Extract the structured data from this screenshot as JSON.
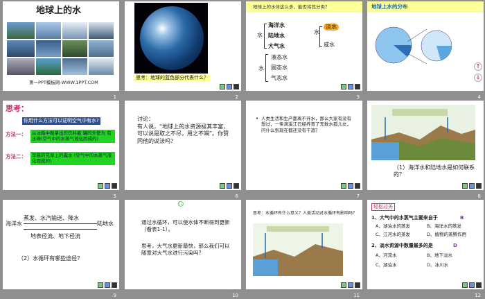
{
  "slides": [
    {
      "num": "1",
      "title": "地球上的水",
      "footer": "第一PPT模板网-WWW.1PPT.COM"
    },
    {
      "num": "2",
      "caption": "思考：地球的蓝色部分代表什么？"
    },
    {
      "num": "3",
      "question": "地球上的水体这么多，能否将其分类？",
      "left_col": [
        "海洋水",
        "陆地水",
        "大气水"
      ],
      "root": "水",
      "right_top": "淡水",
      "right_bottom": "咸水",
      "state_col": [
        "液态水",
        "固态水",
        "气态水"
      ]
    },
    {
      "num": "4",
      "title": "地球上水的分布"
    },
    {
      "num": "5",
      "header": "思考：",
      "subtitle": "你用什么方法可以证明空气中有水?",
      "method1_label": "方法一：",
      "method1_text": "从冰箱中刚拿出的饮料瓶 罐的外壁为 有水珠(空气中的水蒸气液化而成的)",
      "method2_label": "方法二：",
      "method2_text": "早晨的花草上的露水 (空气中的水蒸气液化而成的)"
    },
    {
      "num": "6",
      "label": "讨论：",
      "text": "有人说，“地球上的水资源极其丰富，可以说是取之不尽，用之不竭”。你赞同他的说法吗？"
    },
    {
      "num": "7",
      "bullet": "•",
      "text": "人类生活和生产都离不开水，那么大家有没有想过，一条滴溪江已经养育了无数水孤儿女，问什么到现在都还没有干涸？"
    },
    {
      "num": "8",
      "caption": "（1）海洋水和陆地水是如何联系的？"
    },
    {
      "num": "9",
      "top": "蒸发、水汽输送、降水",
      "left": "海洋水",
      "right": "陆地水",
      "bottom": "地表径流、地下径流",
      "q": "（2）水循环有哪些途径？"
    },
    {
      "num": "10",
      "icon": "☺",
      "p1": "通过水循环，可以使水体不断得到更新（看表1-1）。",
      "p2": "思考，大气水更新最快，那么我们可以随意对大气水进行污染吗？"
    },
    {
      "num": "11",
      "text": "思考：水循环有什么意义？人类活动对水循环有影响吗？"
    },
    {
      "num": "12",
      "badge": "轻松过关",
      "q1": "1、大气中的水蒸气主要来自于",
      "a1": "B",
      "o1": [
        "A、湖泊水的蒸发",
        "B、海洋水的蒸发",
        "C、江河水的蒸发",
        "D、植物的蒸腾作用"
      ],
      "q2": "2、淡水资源中数量最多的是",
      "a2": "D",
      "o2": [
        "A、河流水",
        "B、地下淡水",
        "C、湖泊水",
        "D、冰川水"
      ]
    }
  ]
}
